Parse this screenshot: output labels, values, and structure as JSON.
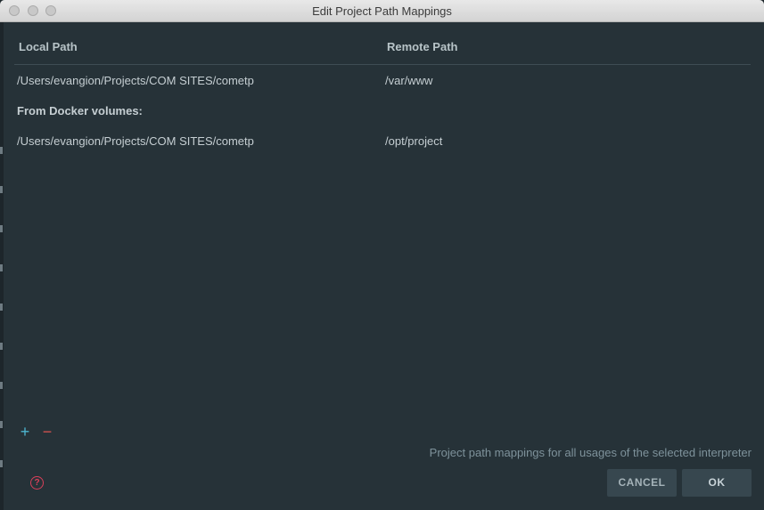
{
  "window": {
    "title": "Edit Project Path Mappings"
  },
  "table": {
    "columns": {
      "local": "Local Path",
      "remote": "Remote Path"
    },
    "rows": [
      {
        "local": "/Users/evangion/Projects/COM SITES/cometp",
        "remote": "/var/www"
      }
    ],
    "docker_group_label": "From Docker volumes:",
    "docker_rows": [
      {
        "local": "/Users/evangion/Projects/COM SITES/cometp",
        "remote": "/opt/project"
      }
    ]
  },
  "toolbar": {
    "add_icon": "plus-icon",
    "add_glyph": "+",
    "remove_icon": "minus-icon",
    "remove_glyph": "−"
  },
  "hint": "Project path mappings for all usages of the selected interpreter",
  "help": {
    "icon": "help-icon",
    "glyph": "?"
  },
  "buttons": {
    "cancel": "CANCEL",
    "ok": "OK"
  },
  "colors": {
    "background": "#263238",
    "add_accent": "#4db6d0",
    "remove_accent": "#d9534f",
    "help_accent": "#d9405a"
  }
}
